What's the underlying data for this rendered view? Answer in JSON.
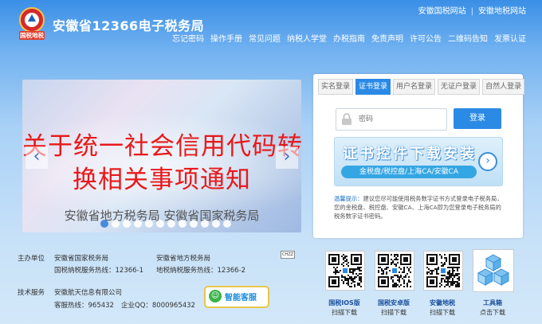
{
  "header": {
    "title": "安徽省12366电子税务局",
    "logo_text": "国税地税",
    "top_links": [
      "安徽国税网站",
      "安徽地税网站"
    ],
    "nav": [
      "忘记密码",
      "操作手册",
      "常见问题",
      "纳税人学堂",
      "办税指南",
      "免责声明",
      "许可公告",
      "二维码告知",
      "发票认证"
    ]
  },
  "banner": {
    "line1": "关于统一社会信用代码转",
    "line2": "换相关事项通知",
    "subtitle": "安徽省地方税务局 安徽省国家税务局",
    "slide_count": 12,
    "active_slide": 1
  },
  "login": {
    "tabs": [
      {
        "label": "实名登录",
        "active": false
      },
      {
        "label": "证书登录",
        "active": true
      },
      {
        "label": "用户名登录",
        "active": false
      },
      {
        "label": "无证户登录",
        "active": false
      },
      {
        "label": "自然人登录",
        "active": false
      }
    ],
    "password_placeholder": "密码",
    "login_button": "登录",
    "download_title": "证书控件下载安装",
    "download_bar": "金税盘/税控盘/上海CA/安徽CA",
    "tip_label": "温馨提示：",
    "tip_text": "建议您尽可能使用税务数字证书方式登录电子税务局，您的金税盘、税控盘、安徽CA、上海CA即为您登录电子税务局的税务数字证书密码。"
  },
  "footer": {
    "host_label": "主办单位",
    "host1": "安徽省国家税务局",
    "host2": "安徽省地方税务局",
    "hotline1": "国税纳税服务热线：12366-1",
    "hotline2": "地税纳税服务热线：12366-2",
    "tech_label": "技术服务",
    "tech_company": "安徽航天信息有限公司",
    "service_hotline": "客服热线：965432",
    "qq": "企业QQ：8000965432",
    "kefu_button": "智能客服",
    "badge": "CHZZ"
  },
  "apps": [
    {
      "label": "国税IOS版",
      "sub": "扫描下载"
    },
    {
      "label": "国税安卓版",
      "sub": "扫描下载"
    },
    {
      "label": "安徽地税",
      "sub": "扫描下载"
    },
    {
      "label": "工具箱",
      "sub": "点击下载"
    }
  ],
  "colors": {
    "accent": "#2a8ae5",
    "banner_text": "#e8191a"
  }
}
